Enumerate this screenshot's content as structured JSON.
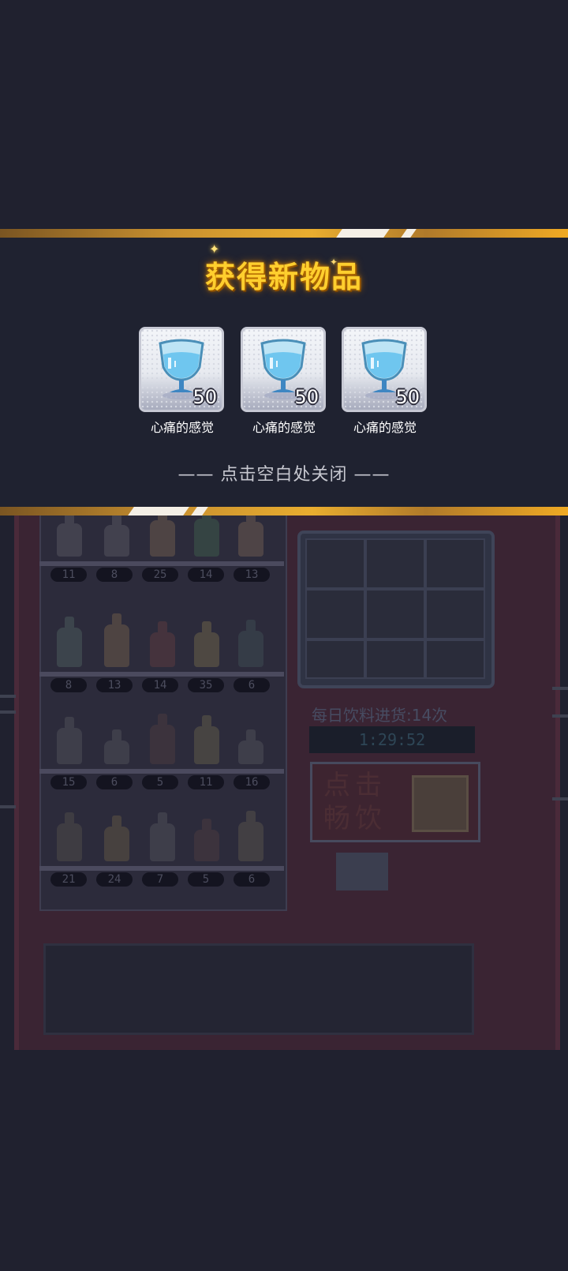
{
  "reward_dialog": {
    "title": "获得新物品",
    "items": [
      {
        "name": "心痛的感觉",
        "count": "50",
        "icon": "water-glass-icon"
      },
      {
        "name": "心痛的感觉",
        "count": "50",
        "icon": "water-glass-icon"
      },
      {
        "name": "心痛的感觉",
        "count": "50",
        "icon": "water-glass-icon"
      }
    ],
    "close_hint": "—— 点击空白处关闭 ——"
  },
  "vending_machine": {
    "stock_rows": [
      [
        "11",
        "8",
        "25",
        "14",
        "13"
      ],
      [
        "8",
        "13",
        "14",
        "35",
        "6"
      ],
      [
        "15",
        "6",
        "5",
        "11",
        "16"
      ],
      [
        "21",
        "24",
        "7",
        "5",
        "6"
      ]
    ],
    "daily_restock_label": "每日饮料进货:14次",
    "restock_timer": "1:29:52",
    "play_button_label": "点击畅饮"
  },
  "colors": {
    "banner_gold": "#e9ad2f",
    "title_yellow": "#ffcf2e",
    "background": "#20212f"
  }
}
